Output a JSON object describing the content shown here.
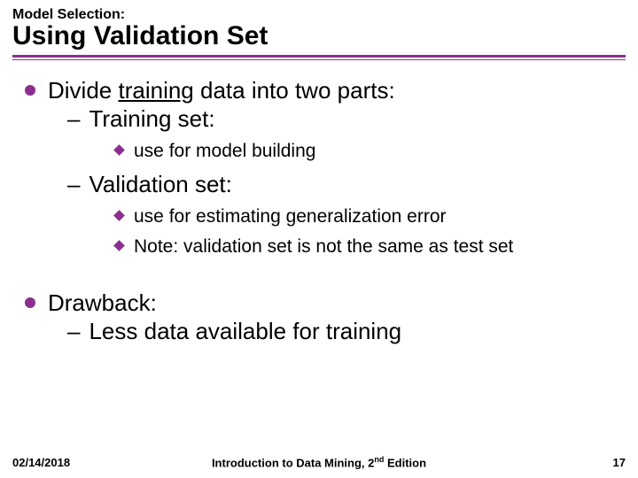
{
  "header": {
    "pretitle": "Model Selection:",
    "title": "Using Validation Set"
  },
  "content": {
    "p1_pre": "Divide ",
    "p1_mid": "training",
    "p1_post": " data into two parts:",
    "p1a": "Training set:",
    "p1a1": "use for model building",
    "p1b": "Validation set:",
    "p1b1": "use for estimating generalization error",
    "p1b2": "Note: validation set is not the same as test set",
    "p2": "Drawback:",
    "p2a": "Less data available for training"
  },
  "footer": {
    "date": "02/14/2018",
    "book_pre": "Introduction to Data Mining, 2",
    "book_sup": "nd",
    "book_post": " Edition",
    "page": "17"
  }
}
